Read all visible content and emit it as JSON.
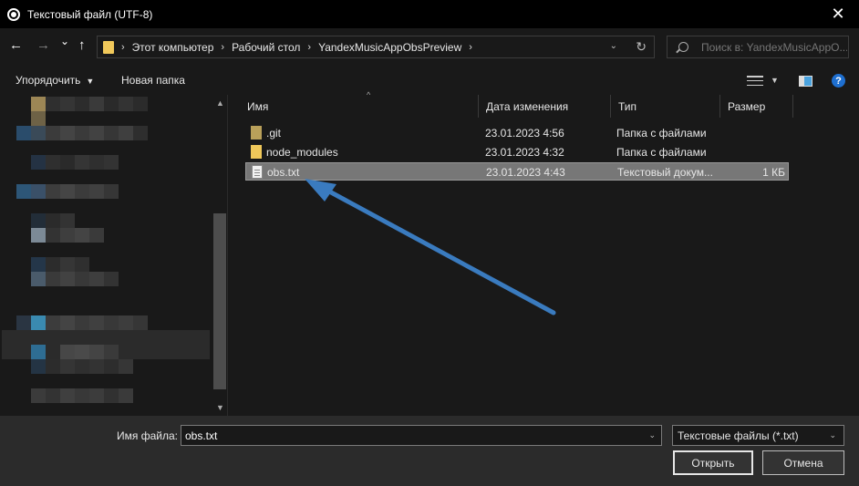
{
  "window": {
    "title": "Текстовый файл (UTF-8)",
    "close_glyph": "✕"
  },
  "nav": {
    "back_glyph": "←",
    "forward_glyph": "→",
    "recent_glyph": "⌄",
    "up_glyph": "↑",
    "breadcrumbs": [
      "Этот компьютер",
      "Рабочий стол",
      "YandexMusicAppObsPreview"
    ],
    "separator": "›",
    "refresh_glyph": "↻",
    "dropdown_glyph": "⌄"
  },
  "search": {
    "placeholder": "Поиск в: YandexMusicAppO..."
  },
  "toolbar": {
    "organize_label": "Упорядочить",
    "new_folder_label": "Новая папка",
    "help_glyph": "?"
  },
  "columns": {
    "name": "Имя",
    "date": "Дата изменения",
    "type": "Тип",
    "size": "Размер"
  },
  "files": [
    {
      "name": ".git",
      "date": "23.01.2023 4:56",
      "type": "Папка с файлами",
      "size": "",
      "icon": "folder-git"
    },
    {
      "name": "node_modules",
      "date": "23.01.2023 4:32",
      "type": "Папка с файлами",
      "size": "",
      "icon": "folder"
    },
    {
      "name": "obs.txt",
      "date": "23.01.2023 4:43",
      "type": "Текстовый докум...",
      "size": "1 КБ",
      "icon": "txt"
    }
  ],
  "bottom": {
    "filename_label": "Имя файла:",
    "filename_value": "obs.txt",
    "filetype_value": "Текстовые файлы (*.txt)",
    "open_label": "Открыть",
    "cancel_label": "Отмена"
  },
  "colors": {
    "accent_arrow": "#3a7bbf",
    "selection": "#777777"
  }
}
